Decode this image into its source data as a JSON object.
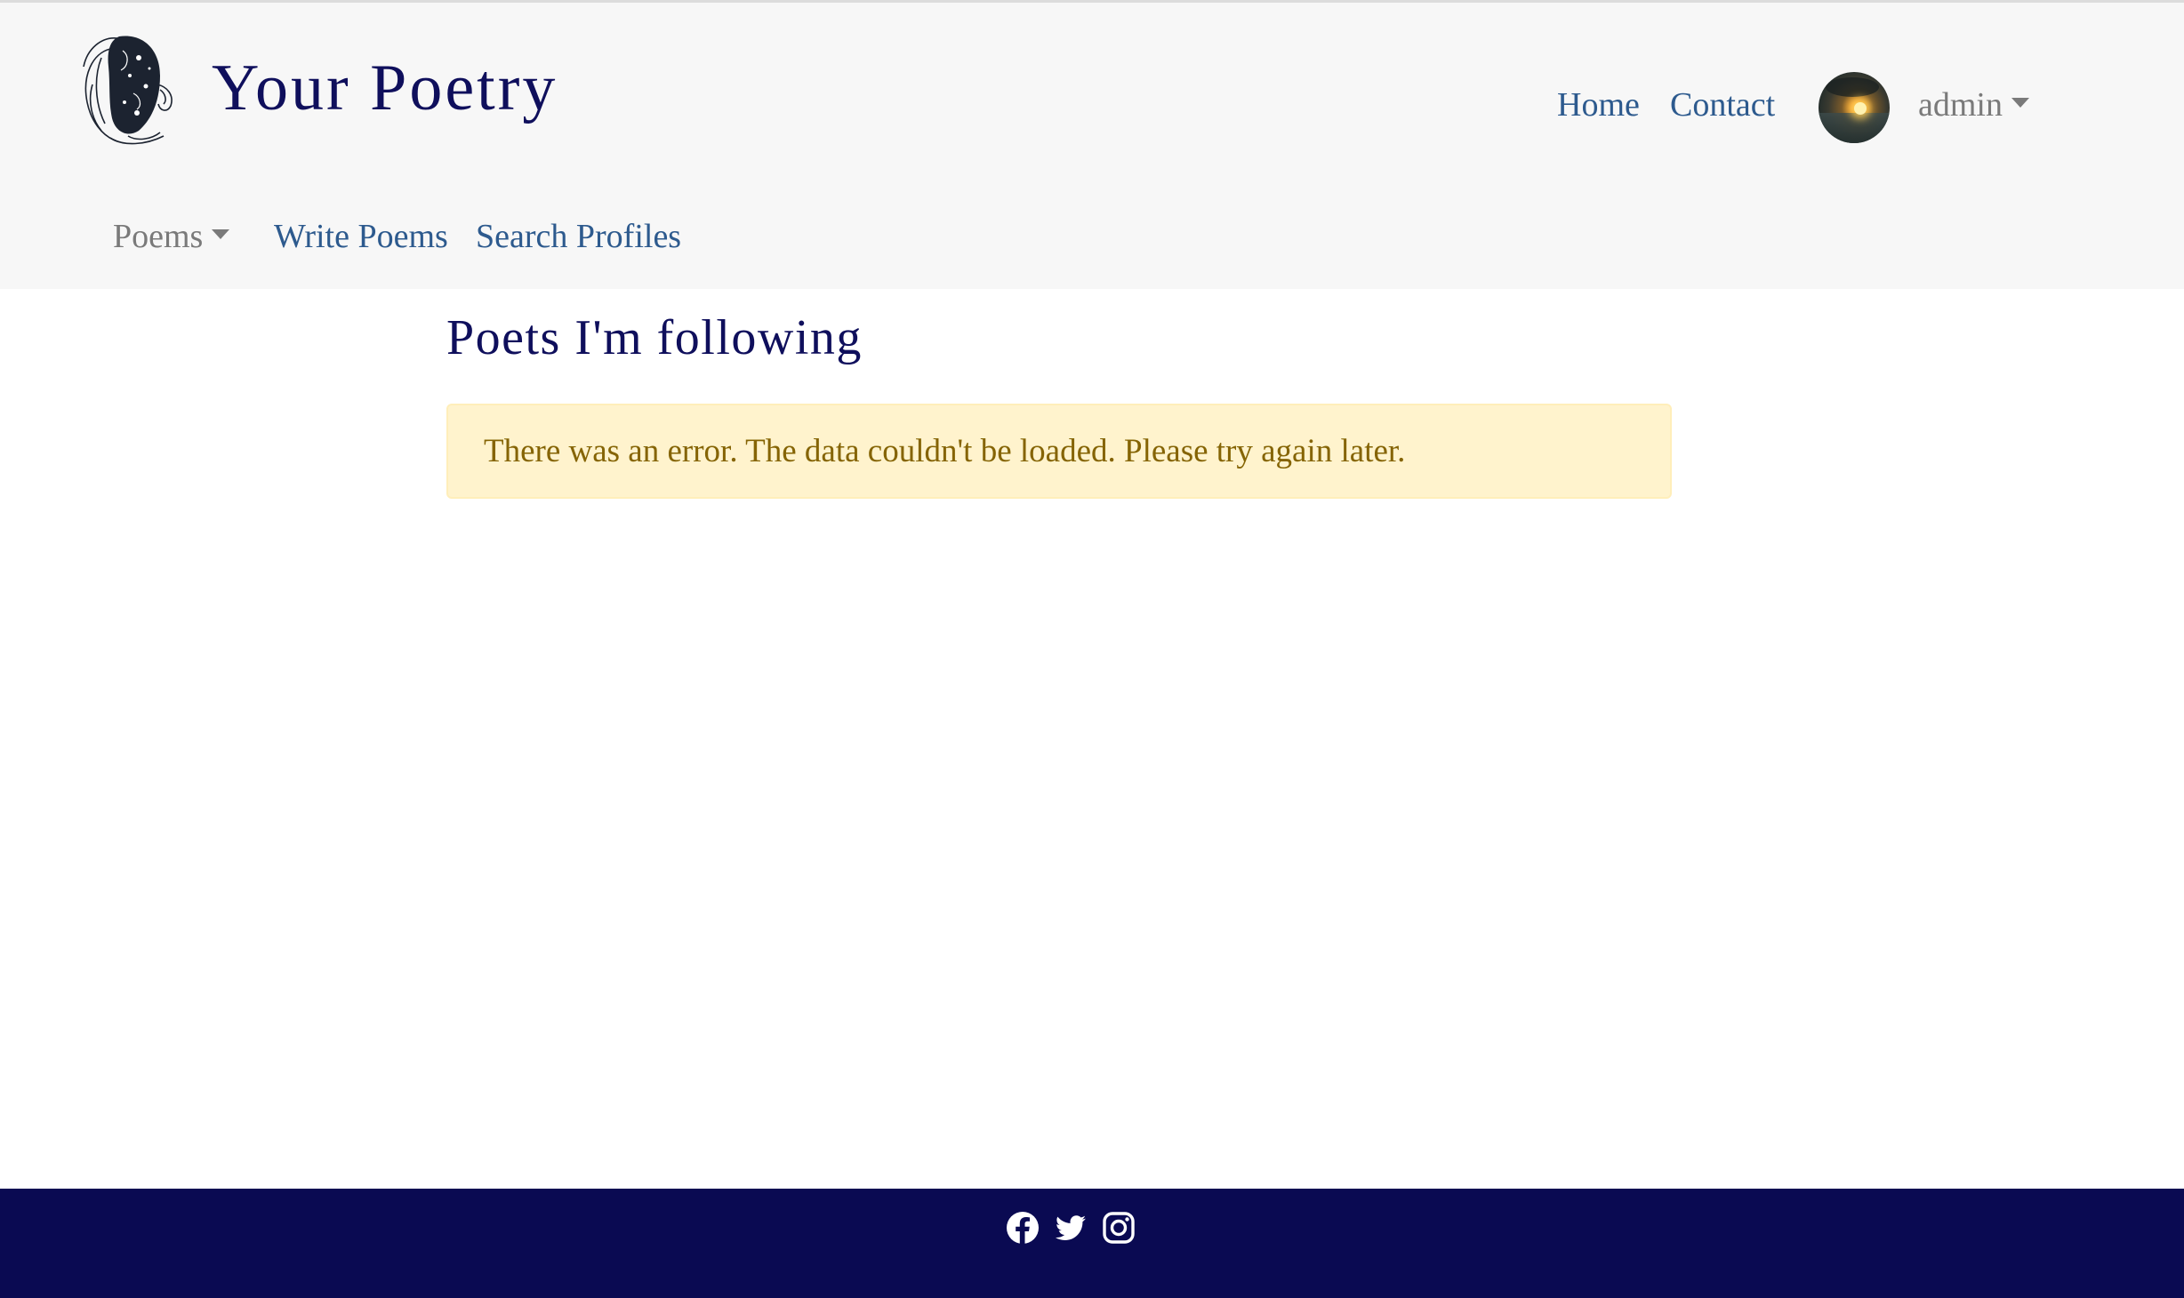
{
  "brand": {
    "title": "Your Poetry",
    "logo_icon": "poet-portrait-logo"
  },
  "header": {
    "nav": {
      "home": "Home",
      "contact": "Contact"
    },
    "user": {
      "avatar_icon": "sunset-avatar",
      "name": "admin"
    }
  },
  "subnav": {
    "poems": "Poems",
    "write_poems": "Write Poems",
    "search_profiles": "Search Profiles"
  },
  "main": {
    "title": "Poets I'm following",
    "alert": "There was an error. The data couldn't be loaded. Please try again later."
  },
  "footer": {
    "icons": [
      "facebook-icon",
      "twitter-icon",
      "instagram-icon"
    ]
  },
  "colors": {
    "navbar_bg": "#f7f7f7",
    "brand": "#0f0f5c",
    "link": "#2d5a8e",
    "muted": "#7a7a7a",
    "alert_bg": "#fff3cd",
    "alert_text": "#856404",
    "footer_bg": "#0a0a52"
  }
}
